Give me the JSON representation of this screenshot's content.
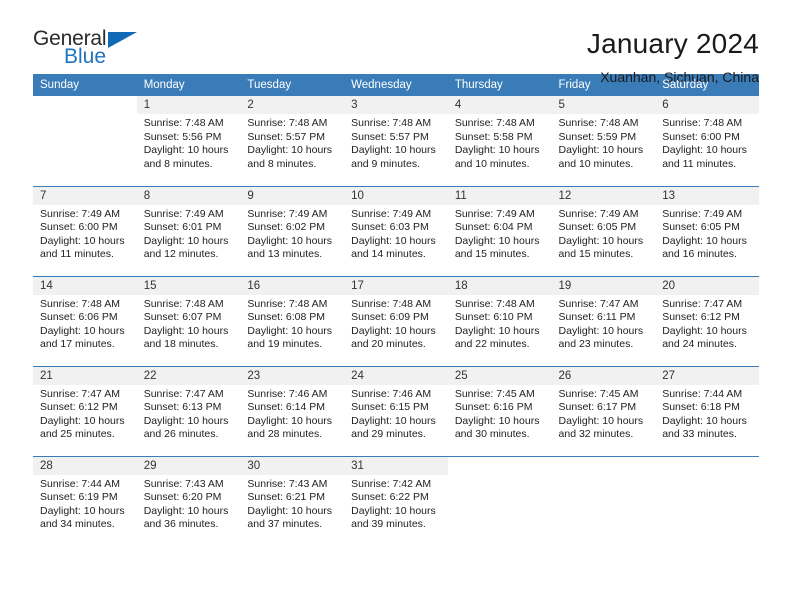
{
  "brand": {
    "name_part1": "General",
    "name_part2": "Blue",
    "accent_color": "#1069b4",
    "triangle_icon": "triangle-icon"
  },
  "header": {
    "title": "January 2024",
    "subtitle": "Xuanhan, Sichuan, China"
  },
  "calendar": {
    "header_bg": "#3a7cb8",
    "daynum_bg": "#f1f1f1",
    "weekdays": [
      "Sunday",
      "Monday",
      "Tuesday",
      "Wednesday",
      "Thursday",
      "Friday",
      "Saturday"
    ],
    "labels": {
      "sunrise": "Sunrise:",
      "sunset": "Sunset:",
      "daylight": "Daylight:"
    },
    "weeks": [
      [
        {
          "day": "",
          "sunrise": "",
          "sunset": "",
          "daylight": "",
          "blank": true
        },
        {
          "day": "1",
          "sunrise": "Sunrise: 7:48 AM",
          "sunset": "Sunset: 5:56 PM",
          "daylight": "Daylight: 10 hours and 8 minutes."
        },
        {
          "day": "2",
          "sunrise": "Sunrise: 7:48 AM",
          "sunset": "Sunset: 5:57 PM",
          "daylight": "Daylight: 10 hours and 8 minutes."
        },
        {
          "day": "3",
          "sunrise": "Sunrise: 7:48 AM",
          "sunset": "Sunset: 5:57 PM",
          "daylight": "Daylight: 10 hours and 9 minutes."
        },
        {
          "day": "4",
          "sunrise": "Sunrise: 7:48 AM",
          "sunset": "Sunset: 5:58 PM",
          "daylight": "Daylight: 10 hours and 10 minutes."
        },
        {
          "day": "5",
          "sunrise": "Sunrise: 7:48 AM",
          "sunset": "Sunset: 5:59 PM",
          "daylight": "Daylight: 10 hours and 10 minutes."
        },
        {
          "day": "6",
          "sunrise": "Sunrise: 7:48 AM",
          "sunset": "Sunset: 6:00 PM",
          "daylight": "Daylight: 10 hours and 11 minutes."
        }
      ],
      [
        {
          "day": "7",
          "sunrise": "Sunrise: 7:49 AM",
          "sunset": "Sunset: 6:00 PM",
          "daylight": "Daylight: 10 hours and 11 minutes."
        },
        {
          "day": "8",
          "sunrise": "Sunrise: 7:49 AM",
          "sunset": "Sunset: 6:01 PM",
          "daylight": "Daylight: 10 hours and 12 minutes."
        },
        {
          "day": "9",
          "sunrise": "Sunrise: 7:49 AM",
          "sunset": "Sunset: 6:02 PM",
          "daylight": "Daylight: 10 hours and 13 minutes."
        },
        {
          "day": "10",
          "sunrise": "Sunrise: 7:49 AM",
          "sunset": "Sunset: 6:03 PM",
          "daylight": "Daylight: 10 hours and 14 minutes."
        },
        {
          "day": "11",
          "sunrise": "Sunrise: 7:49 AM",
          "sunset": "Sunset: 6:04 PM",
          "daylight": "Daylight: 10 hours and 15 minutes."
        },
        {
          "day": "12",
          "sunrise": "Sunrise: 7:49 AM",
          "sunset": "Sunset: 6:05 PM",
          "daylight": "Daylight: 10 hours and 15 minutes."
        },
        {
          "day": "13",
          "sunrise": "Sunrise: 7:49 AM",
          "sunset": "Sunset: 6:05 PM",
          "daylight": "Daylight: 10 hours and 16 minutes."
        }
      ],
      [
        {
          "day": "14",
          "sunrise": "Sunrise: 7:48 AM",
          "sunset": "Sunset: 6:06 PM",
          "daylight": "Daylight: 10 hours and 17 minutes."
        },
        {
          "day": "15",
          "sunrise": "Sunrise: 7:48 AM",
          "sunset": "Sunset: 6:07 PM",
          "daylight": "Daylight: 10 hours and 18 minutes."
        },
        {
          "day": "16",
          "sunrise": "Sunrise: 7:48 AM",
          "sunset": "Sunset: 6:08 PM",
          "daylight": "Daylight: 10 hours and 19 minutes."
        },
        {
          "day": "17",
          "sunrise": "Sunrise: 7:48 AM",
          "sunset": "Sunset: 6:09 PM",
          "daylight": "Daylight: 10 hours and 20 minutes."
        },
        {
          "day": "18",
          "sunrise": "Sunrise: 7:48 AM",
          "sunset": "Sunset: 6:10 PM",
          "daylight": "Daylight: 10 hours and 22 minutes."
        },
        {
          "day": "19",
          "sunrise": "Sunrise: 7:47 AM",
          "sunset": "Sunset: 6:11 PM",
          "daylight": "Daylight: 10 hours and 23 minutes."
        },
        {
          "day": "20",
          "sunrise": "Sunrise: 7:47 AM",
          "sunset": "Sunset: 6:12 PM",
          "daylight": "Daylight: 10 hours and 24 minutes."
        }
      ],
      [
        {
          "day": "21",
          "sunrise": "Sunrise: 7:47 AM",
          "sunset": "Sunset: 6:12 PM",
          "daylight": "Daylight: 10 hours and 25 minutes."
        },
        {
          "day": "22",
          "sunrise": "Sunrise: 7:47 AM",
          "sunset": "Sunset: 6:13 PM",
          "daylight": "Daylight: 10 hours and 26 minutes."
        },
        {
          "day": "23",
          "sunrise": "Sunrise: 7:46 AM",
          "sunset": "Sunset: 6:14 PM",
          "daylight": "Daylight: 10 hours and 28 minutes."
        },
        {
          "day": "24",
          "sunrise": "Sunrise: 7:46 AM",
          "sunset": "Sunset: 6:15 PM",
          "daylight": "Daylight: 10 hours and 29 minutes."
        },
        {
          "day": "25",
          "sunrise": "Sunrise: 7:45 AM",
          "sunset": "Sunset: 6:16 PM",
          "daylight": "Daylight: 10 hours and 30 minutes."
        },
        {
          "day": "26",
          "sunrise": "Sunrise: 7:45 AM",
          "sunset": "Sunset: 6:17 PM",
          "daylight": "Daylight: 10 hours and 32 minutes."
        },
        {
          "day": "27",
          "sunrise": "Sunrise: 7:44 AM",
          "sunset": "Sunset: 6:18 PM",
          "daylight": "Daylight: 10 hours and 33 minutes."
        }
      ],
      [
        {
          "day": "28",
          "sunrise": "Sunrise: 7:44 AM",
          "sunset": "Sunset: 6:19 PM",
          "daylight": "Daylight: 10 hours and 34 minutes."
        },
        {
          "day": "29",
          "sunrise": "Sunrise: 7:43 AM",
          "sunset": "Sunset: 6:20 PM",
          "daylight": "Daylight: 10 hours and 36 minutes."
        },
        {
          "day": "30",
          "sunrise": "Sunrise: 7:43 AM",
          "sunset": "Sunset: 6:21 PM",
          "daylight": "Daylight: 10 hours and 37 minutes."
        },
        {
          "day": "31",
          "sunrise": "Sunrise: 7:42 AM",
          "sunset": "Sunset: 6:22 PM",
          "daylight": "Daylight: 10 hours and 39 minutes."
        },
        {
          "day": "",
          "sunrise": "",
          "sunset": "",
          "daylight": "",
          "blank": true
        },
        {
          "day": "",
          "sunrise": "",
          "sunset": "",
          "daylight": "",
          "blank": true
        },
        {
          "day": "",
          "sunrise": "",
          "sunset": "",
          "daylight": "",
          "blank": true
        }
      ]
    ]
  }
}
